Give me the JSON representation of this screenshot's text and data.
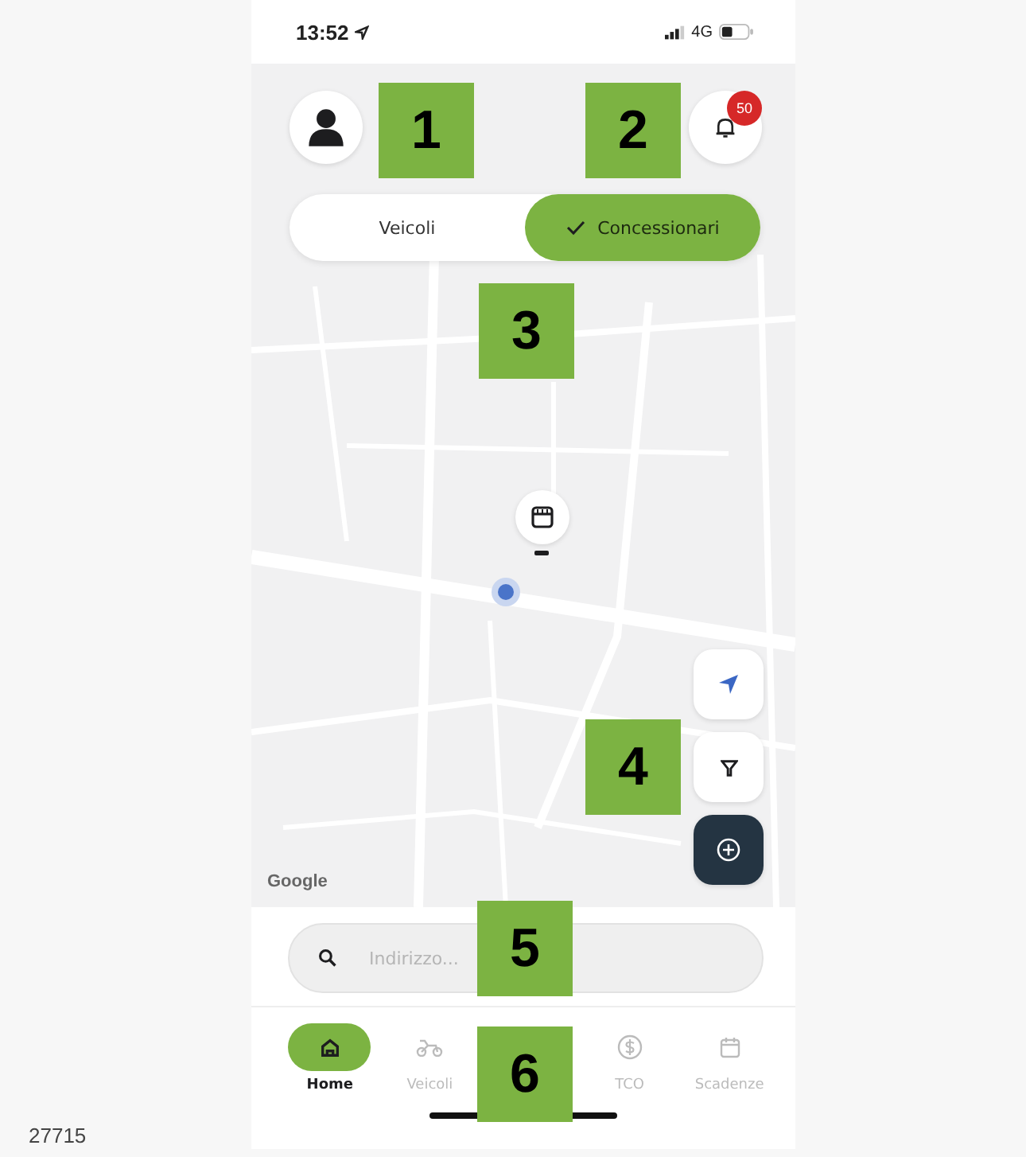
{
  "figure_number": "27715",
  "status_bar": {
    "time": "13:52",
    "network": "4G"
  },
  "header": {
    "notification_count": "50"
  },
  "toggle": [
    {
      "label": "Veicoli",
      "selected": false
    },
    {
      "label": "Concessionari",
      "selected": true
    }
  ],
  "map": {
    "attribution": "Google"
  },
  "map_buttons": [
    {
      "kind": "locate"
    },
    {
      "kind": "filter"
    },
    {
      "kind": "add"
    }
  ],
  "search": {
    "placeholder": "Indirizzo..."
  },
  "nav": [
    {
      "label": "Home",
      "kind": "home",
      "selected": true
    },
    {
      "label": "Veicoli",
      "kind": "vehicles",
      "selected": false
    },
    {
      "label": "TCO",
      "kind": "cost",
      "selected": false
    },
    {
      "label": "Scadenze",
      "kind": "calendar",
      "selected": false
    }
  ],
  "callouts": [
    "1",
    "2",
    "3",
    "4",
    "5",
    "6"
  ]
}
